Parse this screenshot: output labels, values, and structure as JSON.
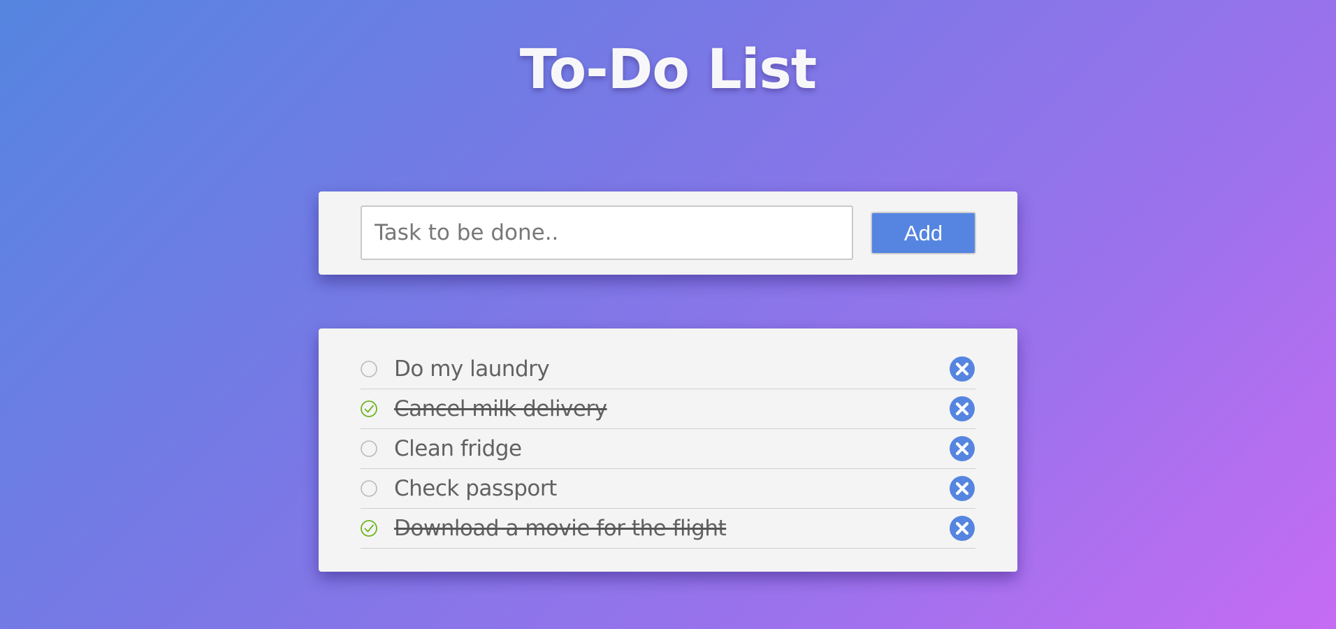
{
  "header": {
    "title": "To-Do List"
  },
  "add_form": {
    "placeholder": "Task to be done..",
    "value": "",
    "add_label": "Add"
  },
  "tasks": [
    {
      "text": "Do my laundry",
      "done": false
    },
    {
      "text": "Cancel milk delivery",
      "done": true
    },
    {
      "text": "Clean fridge",
      "done": false
    },
    {
      "text": "Check passport",
      "done": false
    },
    {
      "text": "Download a movie for the flight",
      "done": true
    }
  ],
  "icons": {
    "unchecked": "empty-circle-icon",
    "checked": "check-circle-icon",
    "delete": "close-circle-icon"
  },
  "colors": {
    "accent": "#5585e0",
    "checked": "#6cb41e",
    "gradient_start": "#5585e0",
    "gradient_end": "#c56cf3"
  }
}
